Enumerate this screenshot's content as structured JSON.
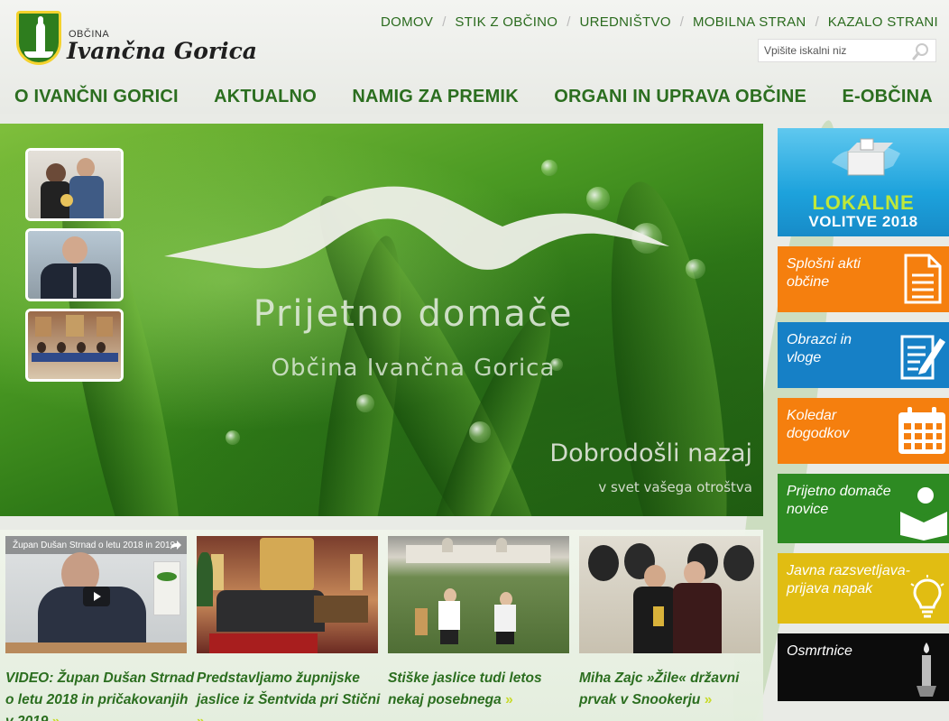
{
  "logo": {
    "small": "OBČINA",
    "big": "Ivančna Gorica"
  },
  "topnav": [
    "DOMOV",
    "STIK Z OBČINO",
    "UREDNIŠTVO",
    "MOBILNA STRAN",
    "KAZALO STRANI"
  ],
  "search": {
    "placeholder": "Vpišite iskalni niz"
  },
  "mainnav": [
    "O IVANČNI GORICI",
    "AKTUALNO",
    "NAMIG ZA PREMIK",
    "ORGANI IN UPRAVA OBČINE",
    "E-OBČINA"
  ],
  "hero": {
    "title": "Prijetno domače",
    "subtitle": "Občina Ivančna Gorica",
    "welcome": "Dobrodošli nazaj",
    "welcome_sub": "v svet vašega otroštva"
  },
  "tiles": [
    {
      "line1": "LOKALNE",
      "line2": "VOLITVE 2018",
      "color": "#1da2dc"
    },
    {
      "label": "Splošni akti\nobčine",
      "color": "#f57f0e"
    },
    {
      "label": "Obrazci in\nvloge",
      "color": "#1680c6"
    },
    {
      "label": "Koledar\ndogodkov",
      "color": "#f57f0e"
    },
    {
      "label": "Prijetno domače\nnovice",
      "color": "#2d8a22"
    },
    {
      "label": "Javna razsvetljava-\nprijava napak",
      "color": "#e1bd12"
    },
    {
      "label": "Osmrtnice",
      "color": "#0c0c0c"
    }
  ],
  "news": [
    {
      "title": "VIDEO: Župan Dušan Strnad o letu 2018 in pričakovanjih v 2019",
      "video_caption": "Župan Dušan Strnad o letu 2018 in 2019"
    },
    {
      "title": "Predstavljamo župnijske jaslice iz Šentvida pri Stični"
    },
    {
      "title": "Stiške jaslice tudi letos nekaj posebnega"
    },
    {
      "title": "Miha Zajc »Žile« državni prvak v Snookerju"
    }
  ],
  "more_symbol": "»",
  "colors": {
    "accent_green": "#2b6e1f",
    "more_yellow": "#c8da2a"
  }
}
